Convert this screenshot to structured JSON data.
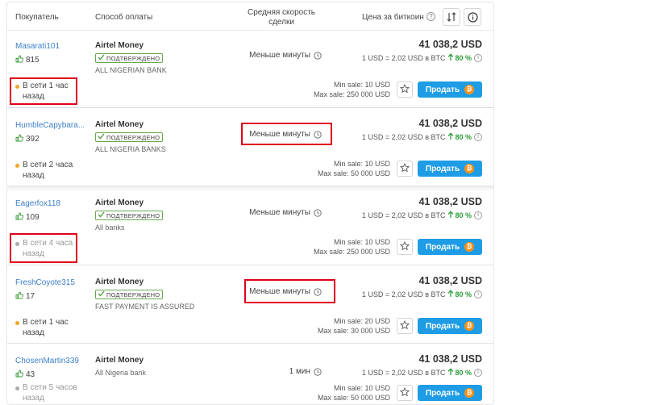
{
  "header": {
    "buyer": "Покупатель",
    "method": "Способ оплаты",
    "speed": "Средняя скорость сделки",
    "price": "Цена за биткоин",
    "help_glyph": "?"
  },
  "icons": {
    "thumb": "thumbs-up-icon",
    "check": "check-icon",
    "clock": "clock-icon",
    "star": "star-icon",
    "bitcoin": "bitcoin-icon",
    "sort": "sort-icon",
    "info": "info-icon"
  },
  "colors": {
    "link": "#3d7fc9",
    "accent_button": "#1e9ce5",
    "positive": "#2a9d3a",
    "online_dot": "#f0a826",
    "offline_dot": "#aaaaaa",
    "highlight": "#e0001b",
    "bitcoin": "#f7931a"
  },
  "rows": [
    {
      "username": "Masarati101",
      "rating": "815",
      "status": "В сети 1 час назад",
      "status_kind": "online",
      "method": "Airtel Money",
      "verified": "ПОДТВЕРЖДЕНО",
      "bank": "ALL NIGERIAN BANK",
      "speed": "Меньше минуты",
      "price": "41 038,2 USD",
      "rate": "1 USD = 2,02 USD в BTC",
      "percent": "80 %",
      "min_sale": "Min sale: 10 USD",
      "max_sale": "Max sale: 250 000 USD",
      "sell_label": "Продать"
    },
    {
      "username": "HumbleCapybara...",
      "rating": "392",
      "status": "В сети 2 часа назад",
      "status_kind": "online",
      "method": "Airtel Money",
      "verified": "ПОДТВЕРЖДЕНО",
      "bank": "ALL NIGERIA BANKS",
      "speed": "Меньше минуты",
      "price": "41 038,2 USD",
      "rate": "1 USD = 2,02 USD в BTC",
      "percent": "80 %",
      "min_sale": "Min sale: 10 USD",
      "max_sale": "Max sale: 50 000 USD",
      "sell_label": "Продать"
    },
    {
      "username": "Eagerfox118",
      "rating": "109",
      "status": "В сети 4 часа назад",
      "status_kind": "offline",
      "method": "Airtel Money",
      "verified": "ПОДТВЕРЖДЕНО",
      "bank": "All banks",
      "speed": "Меньше минуты",
      "price": "41 038,2 USD",
      "rate": "1 USD = 2,02 USD в BTC",
      "percent": "80 %",
      "min_sale": "Min sale: 10 USD",
      "max_sale": "Max sale: 250 000 USD",
      "sell_label": "Продать"
    },
    {
      "username": "FreshCoyote315",
      "rating": "17",
      "status": "В сети 1 час назад",
      "status_kind": "online",
      "method": "Airtel Money",
      "verified": "ПОДТВЕРЖДЕНО",
      "bank": "FAST PAYMENT IS ASSURED",
      "speed": "Меньше минуты",
      "price": "41 038,2 USD",
      "rate": "1 USD = 2,02 USD в BTC",
      "percent": "80 %",
      "min_sale": "Min sale: 20 USD",
      "max_sale": "Max sale: 30 000 USD",
      "sell_label": "Продать"
    },
    {
      "username": "ChosenMartin339",
      "rating": "43",
      "status": "В сети 5 часов назад",
      "status_kind": "offline",
      "method": "Airtel Money",
      "verified": "",
      "bank": "All Nigeria bank",
      "speed": "1 мин",
      "price": "41 038,2 USD",
      "rate": "1 USD = 2,02 USD в BTC",
      "percent": "80 %",
      "min_sale": "Min sale: 10 USD",
      "max_sale": "Max sale: 50 000 USD",
      "sell_label": "Продать"
    }
  ]
}
